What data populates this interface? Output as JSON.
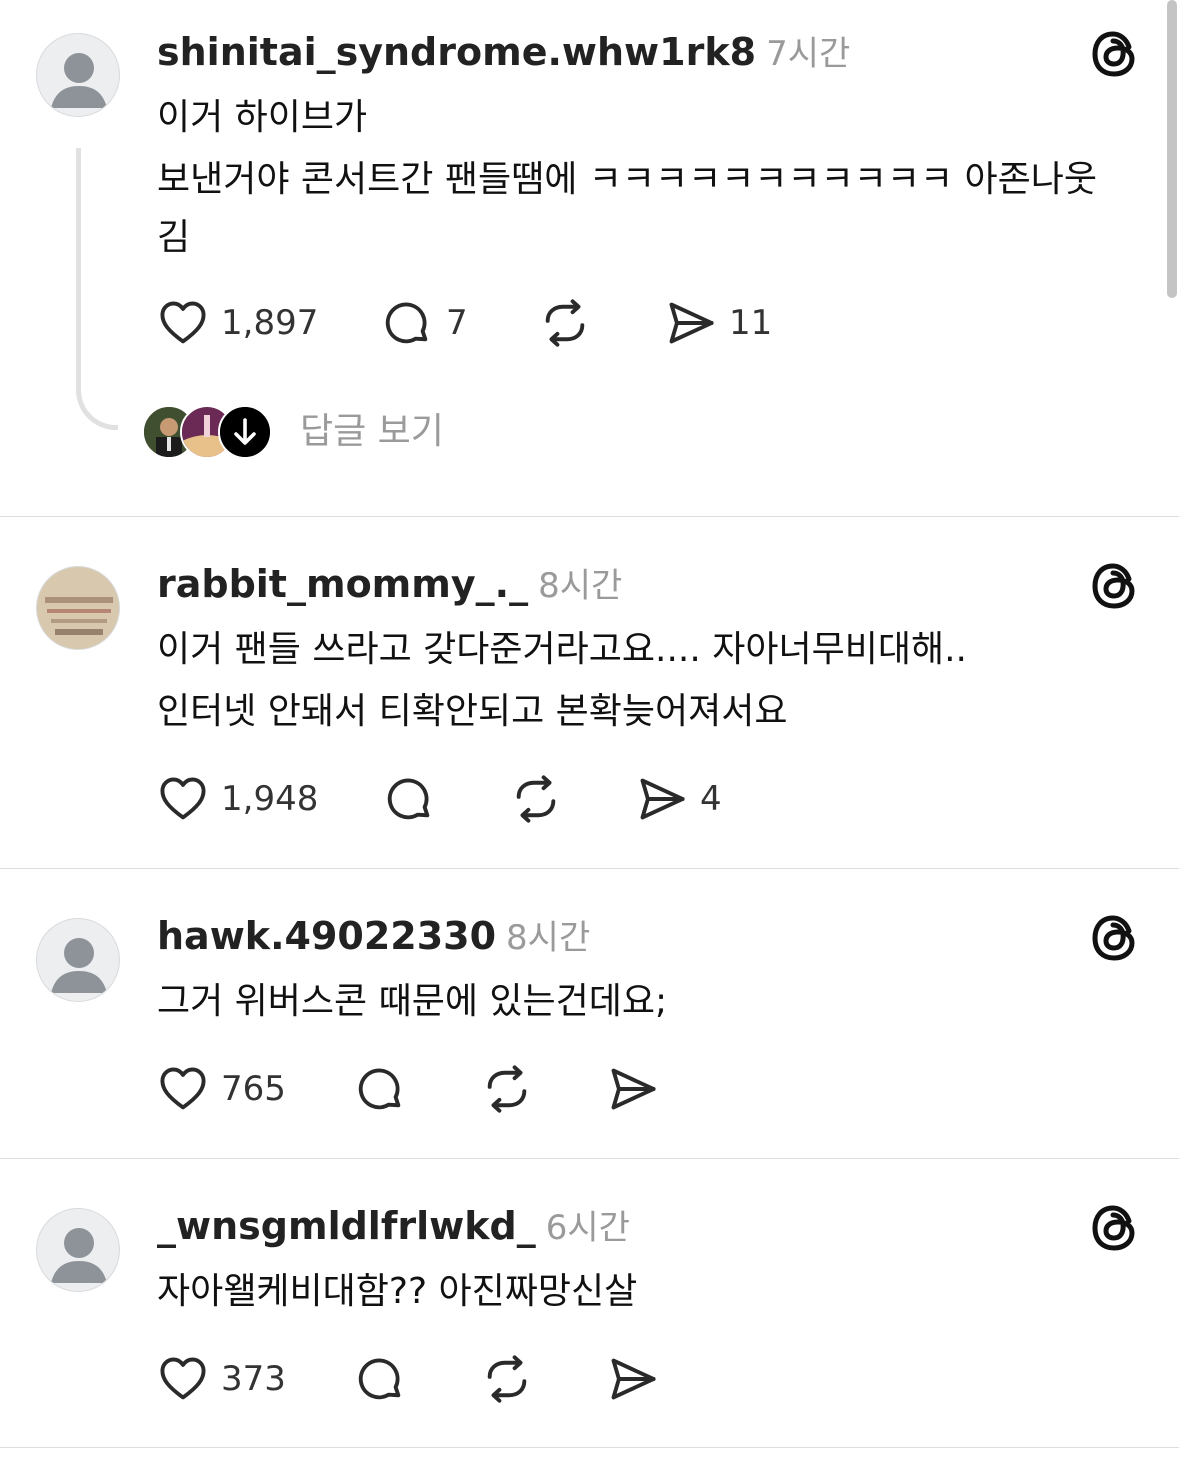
{
  "posts": [
    {
      "username": "shinitai_syndrome.whw1rk8",
      "time": "7시간",
      "lines": [
        "이거 하이브가",
        "보낸거야 콘서트간 팬들땜에 ㅋㅋㅋㅋㅋㅋㅋㅋㅋㅋㅋ 아존나웃",
        "김"
      ],
      "likes": "1,897",
      "comments": "7",
      "reposts": "",
      "shares": "11",
      "view_replies": "답글 보기"
    },
    {
      "username": "rabbit_mommy_._",
      "time": "8시간",
      "lines": [
        "이거 팬들 쓰라고 갖다준거라고요.... 자아너무비대해..",
        "인터넷 안돼서 티확안되고 본확늦어져서요"
      ],
      "likes": "1,948",
      "comments": "",
      "reposts": "",
      "shares": "4"
    },
    {
      "username": "hawk.49022330",
      "time": "8시간",
      "lines": [
        "그거 위버스콘 때문에 있는건데요;"
      ],
      "likes": "765",
      "comments": "",
      "reposts": "",
      "shares": ""
    },
    {
      "username": "_wnsgmldlfrlwkd_",
      "time": "6시간",
      "lines": [
        "자아왤케비대함?? 아진짜망신살"
      ],
      "likes": "373",
      "comments": "",
      "reposts": "",
      "shares": ""
    }
  ],
  "colors": {
    "text": "#111111",
    "muted": "#9a9a9a",
    "divider": "#dedede",
    "avatar_bg": "#eceef0"
  }
}
